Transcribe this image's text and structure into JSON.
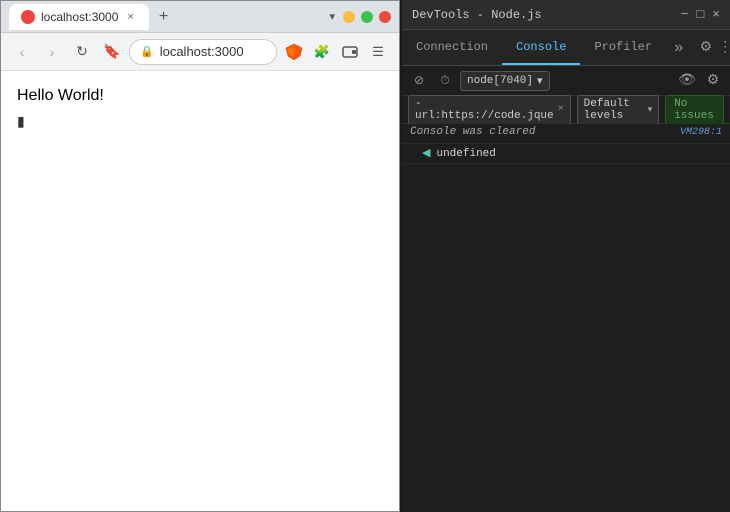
{
  "browser": {
    "tab": {
      "title": "localhost:3000",
      "close_btn": "×",
      "new_tab_btn": "+"
    },
    "window_controls": {
      "close": "×",
      "minimize": "−",
      "maximize": "□"
    },
    "dropdown_btn": "▾",
    "address": "localhost:3000",
    "nav": {
      "back": "‹",
      "forward": "›",
      "reload": "↻",
      "bookmark": "🔖"
    },
    "content": {
      "hello": "Hello World!"
    }
  },
  "devtools": {
    "title": "DevTools - Node.js",
    "win_controls": {
      "minimize": "−",
      "maximize": "□",
      "close": "×"
    },
    "tabs": [
      {
        "label": "Connection",
        "active": false
      },
      {
        "label": "Console",
        "active": true
      },
      {
        "label": "Profiler",
        "active": false
      }
    ],
    "more_tabs": "»",
    "toolbar": {
      "clear_btn": "🚫",
      "history_btn": "⏱",
      "node_selector": "node[7040]",
      "node_arrow": "▾",
      "eye_btn": "👁",
      "settings_btn": "⚙"
    },
    "filter": {
      "url_tag": "-url:https://code.jque",
      "tag_close": "×",
      "levels": "Default levels",
      "levels_arrow": "▾",
      "issues": "No issues"
    },
    "console_output": [
      {
        "type": "cleared",
        "text": "Console was cleared",
        "file": "VM298:1"
      },
      {
        "type": "undefined",
        "arrow": "◀",
        "text": "undefined"
      }
    ],
    "settings_icon": "⚙"
  }
}
